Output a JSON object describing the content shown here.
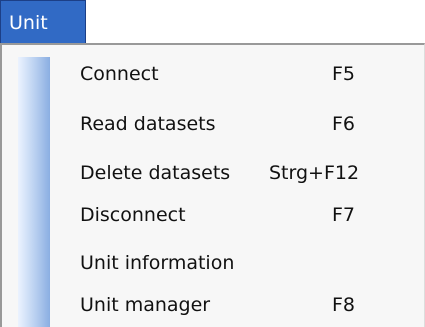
{
  "menubar": {
    "active_menu": "Unit"
  },
  "menu": {
    "items": [
      {
        "label": "Connect",
        "shortcut": "F5"
      },
      {
        "label": "Read datasets",
        "shortcut": "F6"
      },
      {
        "label": "Delete datasets",
        "shortcut": "Strg+F12"
      },
      {
        "label": "Disconnect",
        "shortcut": "F7"
      },
      {
        "label": "Unit information",
        "shortcut": ""
      },
      {
        "label": "Unit manager",
        "shortcut": "F8"
      }
    ]
  },
  "colors": {
    "menubar_active_bg": "#316ac5",
    "menu_bg": "#f7f7f7",
    "gutter_gradient_start": "#ecf3ff",
    "gutter_gradient_end": "#8aaee2",
    "menu_text": "#111111"
  }
}
